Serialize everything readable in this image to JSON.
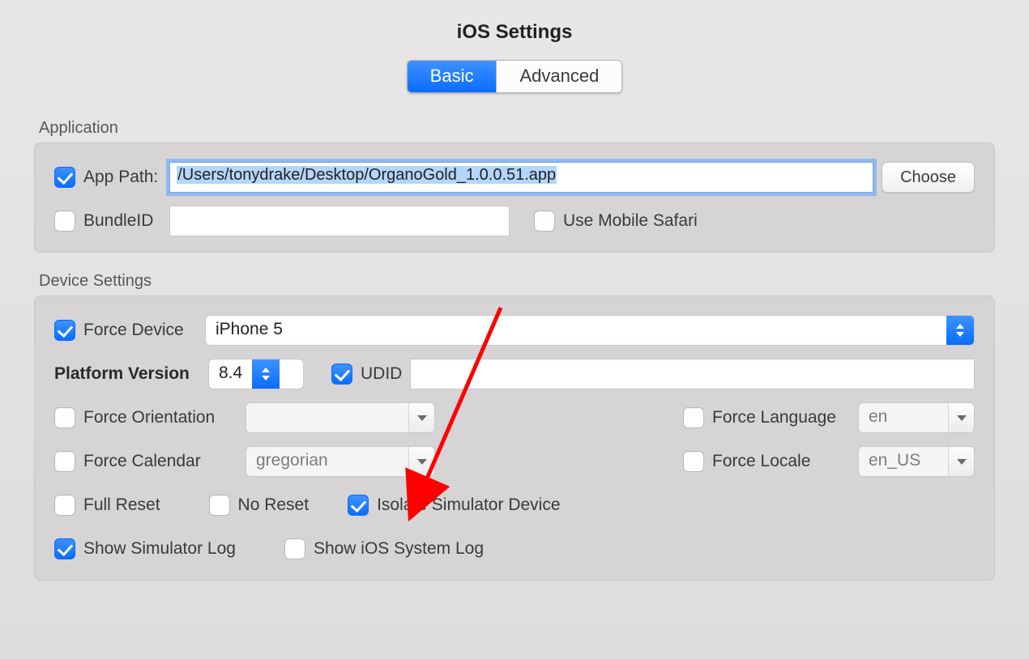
{
  "title": "iOS Settings",
  "tabs": {
    "basic": "Basic",
    "advanced": "Advanced",
    "active": "basic"
  },
  "application": {
    "section_label": "Application",
    "app_path_checked": true,
    "app_path_label": "App Path:",
    "app_path_value": "/Users/tonydrake/Desktop/OrganoGold_1.0.0.51.app",
    "choose_label": "Choose",
    "bundle_id_checked": false,
    "bundle_id_label": "BundleID",
    "bundle_id_value": "",
    "use_mobile_safari_checked": false,
    "use_mobile_safari_label": "Use Mobile Safari"
  },
  "device": {
    "section_label": "Device Settings",
    "force_device_checked": true,
    "force_device_label": "Force Device",
    "force_device_value": "iPhone 5",
    "platform_version_label": "Platform Version",
    "platform_version_value": "8.4",
    "udid_checked": true,
    "udid_label": "UDID",
    "udid_value": "",
    "force_orientation_checked": false,
    "force_orientation_label": "Force Orientation",
    "force_orientation_value": "",
    "force_language_checked": false,
    "force_language_label": "Force Language",
    "force_language_value": "en",
    "force_calendar_checked": false,
    "force_calendar_label": "Force Calendar",
    "force_calendar_value": "gregorian",
    "force_locale_checked": false,
    "force_locale_label": "Force Locale",
    "force_locale_value": "en_US",
    "full_reset_checked": false,
    "full_reset_label": "Full Reset",
    "no_reset_checked": false,
    "no_reset_label": "No Reset",
    "isolate_sim_checked": true,
    "isolate_sim_label": "Isolate Simulator Device",
    "show_sim_log_checked": true,
    "show_sim_log_label": "Show Simulator Log",
    "show_ios_log_checked": false,
    "show_ios_log_label": "Show iOS System Log"
  }
}
